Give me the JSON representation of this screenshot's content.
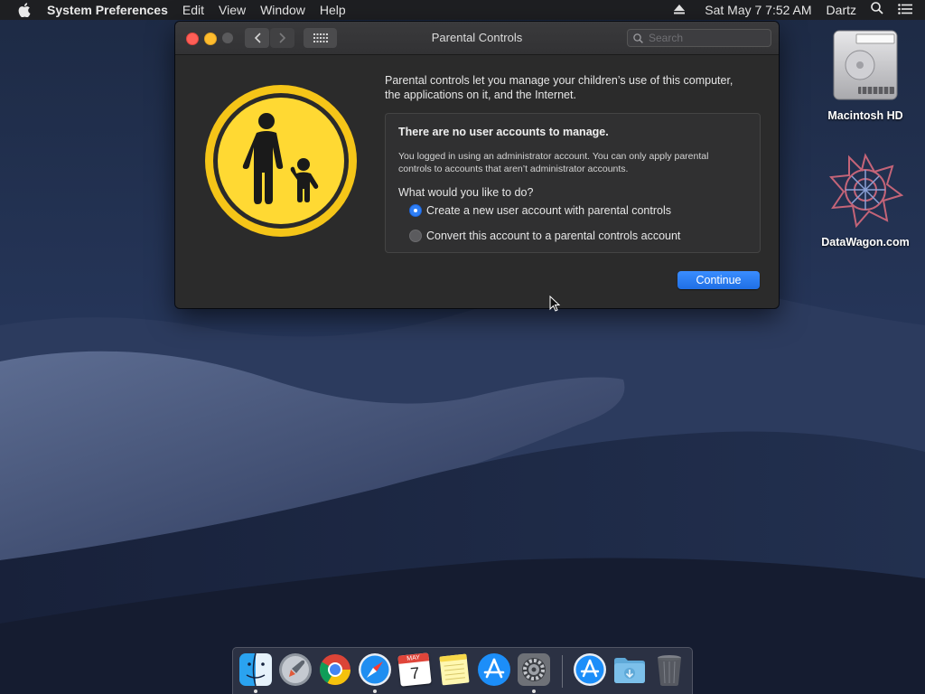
{
  "menubar": {
    "app_name": "System Preferences",
    "menus": [
      "Edit",
      "View",
      "Window",
      "Help"
    ],
    "datetime": "Sat May 7  7:52 AM",
    "user": "Dartz"
  },
  "window": {
    "title": "Parental Controls",
    "search_placeholder": "Search",
    "intro": "Parental controls let you manage your children’s use of this computer, the applications on it, and the Internet.",
    "headline": "There are no user accounts to manage.",
    "note": "You logged in using an administrator account. You can only apply parental controls to accounts that aren’t administrator accounts.",
    "question": "What would you like to do?",
    "options": [
      {
        "label": "Create a new user account with parental controls",
        "selected": true
      },
      {
        "label": "Convert this account to a parental controls account",
        "selected": false
      }
    ],
    "continue_label": "Continue"
  },
  "desktop": {
    "icons": [
      {
        "label": "Macintosh HD",
        "icon": "hard-drive-icon"
      },
      {
        "label": "DataWagon.com",
        "icon": "datawagon-logo-icon"
      }
    ]
  },
  "dock": {
    "items": [
      "finder-icon",
      "launchpad-icon",
      "chrome-icon",
      "safari-icon",
      "calendar-icon",
      "notes-icon",
      "app-store-icon",
      "system-preferences-icon",
      "app-store-downloads-icon",
      "downloads-folder-icon",
      "trash-icon"
    ],
    "calendar_month": "MAY",
    "calendar_day": "7"
  },
  "colors": {
    "accent": "#2f7ff5",
    "badge_yellow": "#f5c518",
    "window_bg": "#2b2b2b"
  }
}
